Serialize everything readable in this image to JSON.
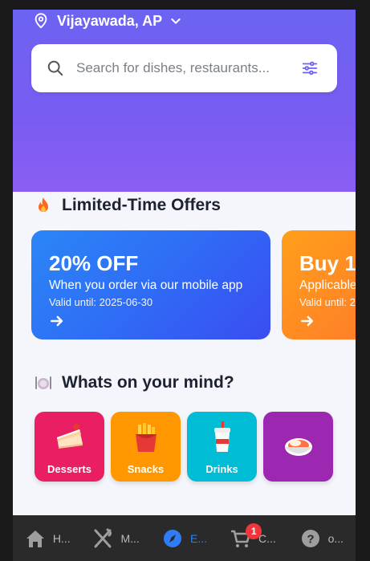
{
  "header": {
    "location": "Vijayawada, AP",
    "location_icon": "map-pin-icon",
    "dropdown_icon": "chevron-down-icon"
  },
  "search": {
    "placeholder": "Search for dishes, restaurants...",
    "value": "",
    "icon": "search-icon",
    "filter_icon": "sliders-icon"
  },
  "offers_section": {
    "title": "Limited-Time Offers",
    "icon": "fire-icon",
    "offers": [
      {
        "headline": "20% OFF",
        "description": "When you order via our mobile app",
        "valid": "Valid until: 2025-06-30",
        "color": "#2f6cf6"
      },
      {
        "headline": "Buy 1",
        "description": "Applicable",
        "valid": "Valid until: 2",
        "color": "#ff7b2a"
      }
    ]
  },
  "categories_section": {
    "title": "Whats on your mind?",
    "icon": "plate-cutlery-icon",
    "items": [
      {
        "label": "Desserts",
        "icon": "cake-icon",
        "color": "#e91e63"
      },
      {
        "label": "Snacks",
        "icon": "fries-icon",
        "color": "#ff9800"
      },
      {
        "label": "Drinks",
        "icon": "soda-cup-icon",
        "color": "#00bcd4"
      },
      {
        "label": "",
        "icon": "curry-bowl-icon",
        "color": "#9c27b0"
      }
    ]
  },
  "bottom_nav": {
    "items": [
      {
        "label": "H...",
        "icon": "home-icon"
      },
      {
        "label": "M...",
        "icon": "utensils-icon"
      },
      {
        "label": "E...",
        "icon": "compass-icon",
        "active": true
      },
      {
        "label": "C...",
        "icon": "cart-icon",
        "badge": "1"
      },
      {
        "label": "o...",
        "icon": "help-circle-icon"
      }
    ]
  }
}
